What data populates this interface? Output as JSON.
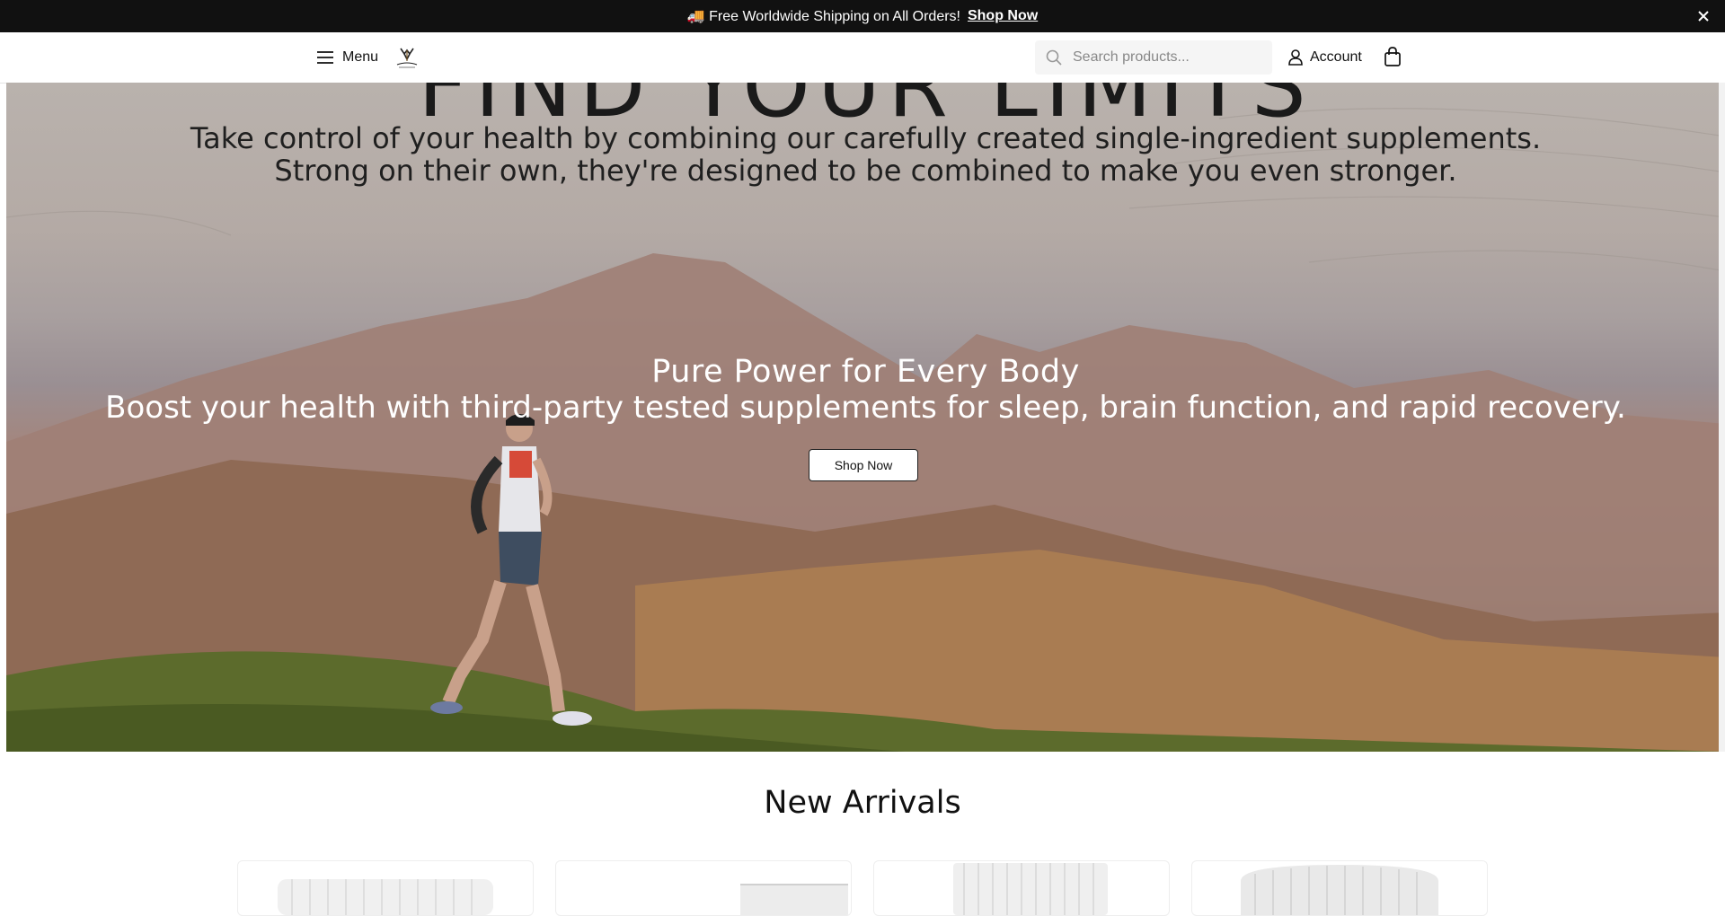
{
  "announcement": {
    "icon": "truck-icon",
    "text": "🚚 Free Worldwide Shipping on All Orders!",
    "link_label": "Shop Now"
  },
  "header": {
    "menu_label": "Menu",
    "search_placeholder": "Search products...",
    "account_label": "Account"
  },
  "hero": {
    "heading_partial": "FIND YOUR LIMITS",
    "intro_line1": "Take control of your health by combining our carefully created single-ingredient supplements.",
    "intro_line2": "Strong on their own, they're designed to be combined to make you even stronger.",
    "title": "Pure Power for Every Body",
    "subtitle": "Boost your health with third-party tested supplements for sleep, brain function, and rapid recovery.",
    "button_label": "Shop Now"
  },
  "new_arrivals": {
    "title": "New Arrivals",
    "products": [
      {
        "image": "supplement-jar"
      },
      {
        "image": "supplement-box"
      },
      {
        "image": "supplement-tub"
      },
      {
        "image": "supplement-jar"
      }
    ]
  },
  "colors": {
    "announcement_bg": "#111111",
    "header_bg": "#ffffff",
    "hero_text": "#ffffff"
  }
}
